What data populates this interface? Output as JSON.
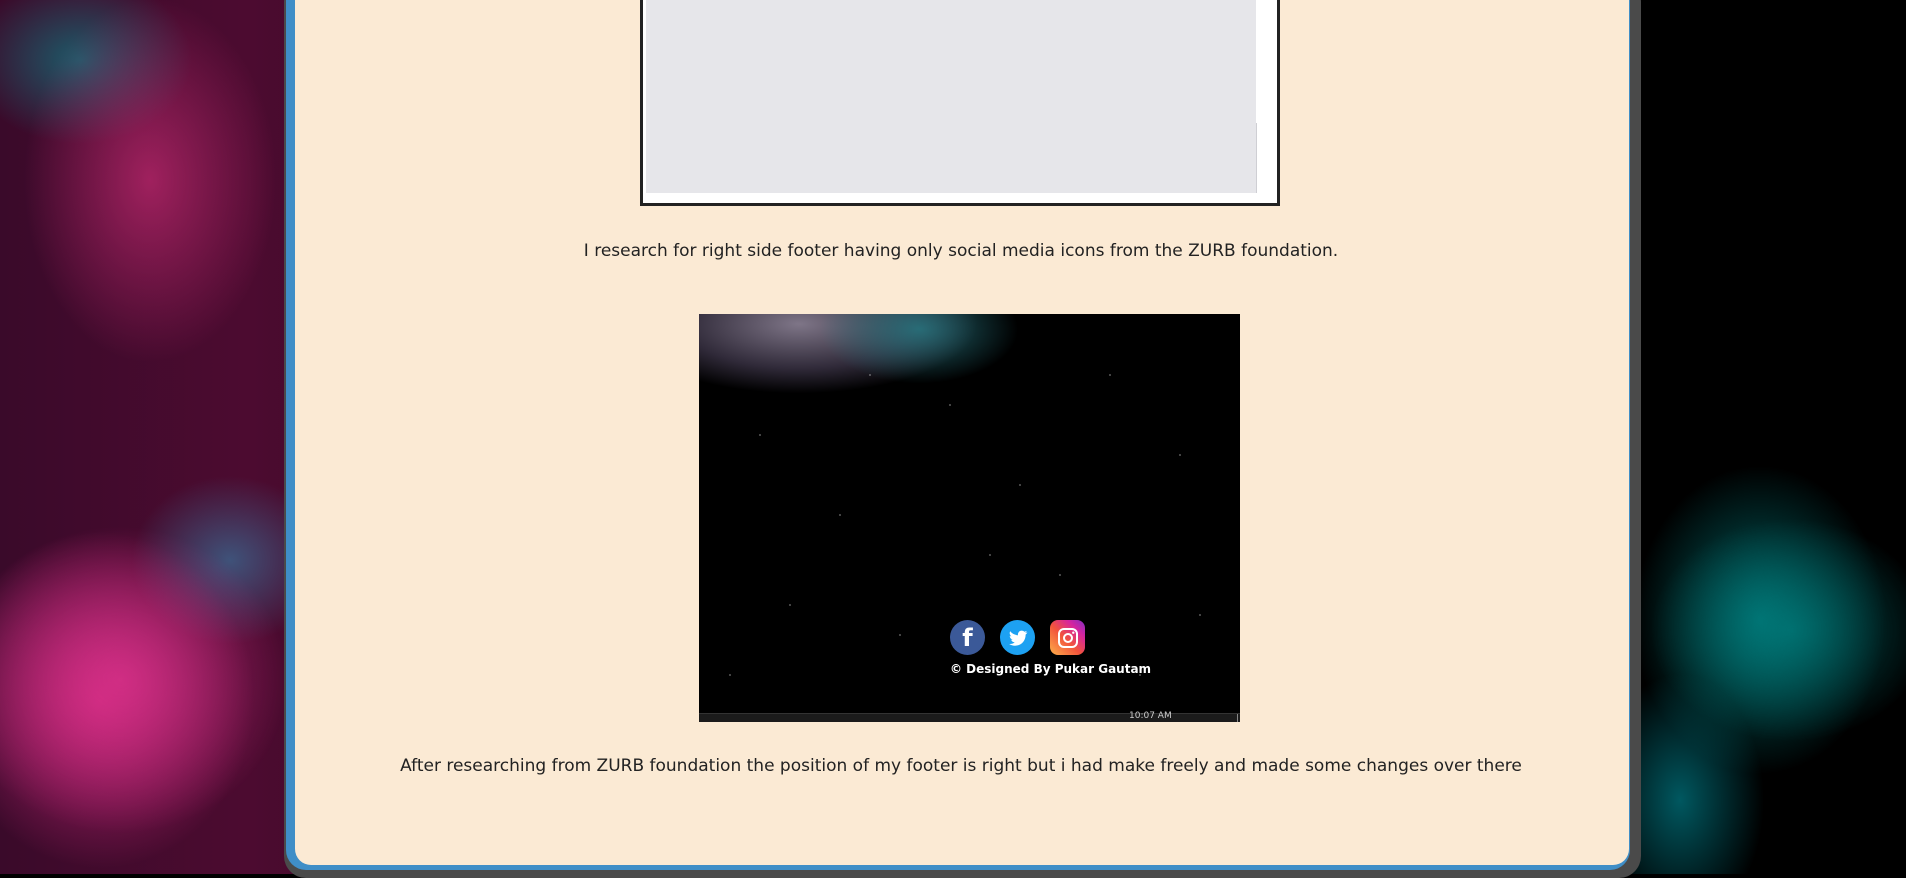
{
  "captions": {
    "first": "I research for right side footer having only social media icons from the ZURB foundation.",
    "second": "After researching from ZURB foundation the position of my footer is right but i had make freely and made some changes over there"
  },
  "screenshot2": {
    "credit": "© Designed By Pukar Gautam",
    "time": "10:07 AM",
    "icons": [
      "facebook-icon",
      "twitter-icon",
      "instagram-icon"
    ]
  },
  "colors": {
    "card_border": "#3f8ec7",
    "card_background": "#fbead4",
    "facebook": "#3b5998",
    "twitter": "#1da1f2"
  }
}
